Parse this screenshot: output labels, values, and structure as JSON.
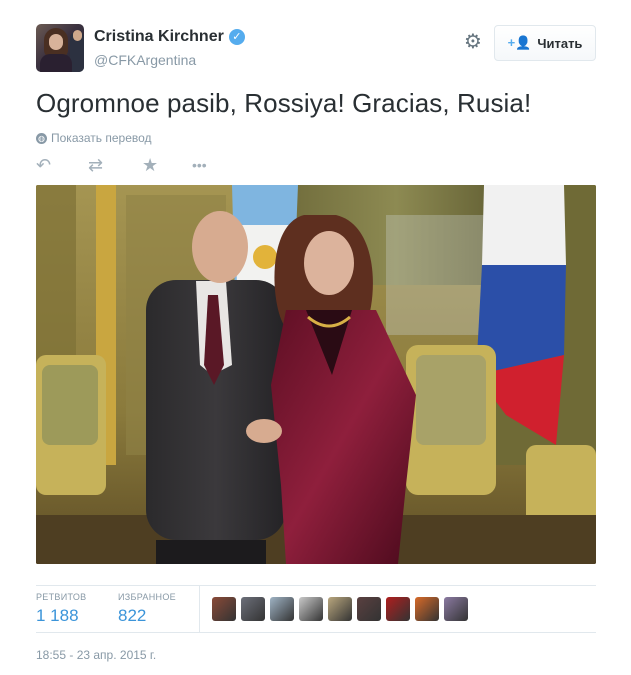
{
  "profile": {
    "name": "Cristina Kirchner",
    "handle": "@CFKArgentina",
    "verified_glyph": "✓",
    "avatar_icon": "user-avatar-photo"
  },
  "header": {
    "gear_glyph": "⚙",
    "follow_icon": "+👤",
    "follow_label": "Читать"
  },
  "tweet": {
    "text": "Ogromnoe pasib, Rossiya! Gracias, Rusia!",
    "translate_label": "Показать перевод",
    "globe_glyph": "◍"
  },
  "actions": {
    "reply_glyph": "↶",
    "retweet_glyph": "⇄",
    "favorite_glyph": "★",
    "more_glyph": "•••"
  },
  "stats": {
    "retweets_label": "РЕТВИТОВ",
    "retweets_value": "1 188",
    "favorites_label": "ИЗБРАННОЕ",
    "favorites_value": "822"
  },
  "favoriters": [
    {
      "color": "#8a4a38"
    },
    {
      "color": "#6c6f7a"
    },
    {
      "color": "#9fb3c4"
    },
    {
      "color": "#c9c9c9"
    },
    {
      "color": "#b9a77e"
    },
    {
      "color": "#5a4040"
    },
    {
      "color": "#b01e1e"
    },
    {
      "color": "#d86a28"
    },
    {
      "color": "#8b7aa2"
    }
  ],
  "timestamp": "18:55 - 23 апр. 2015 г.",
  "colors": {
    "link": "#3b94d9",
    "muted": "#8899a6",
    "verified": "#55acee"
  }
}
